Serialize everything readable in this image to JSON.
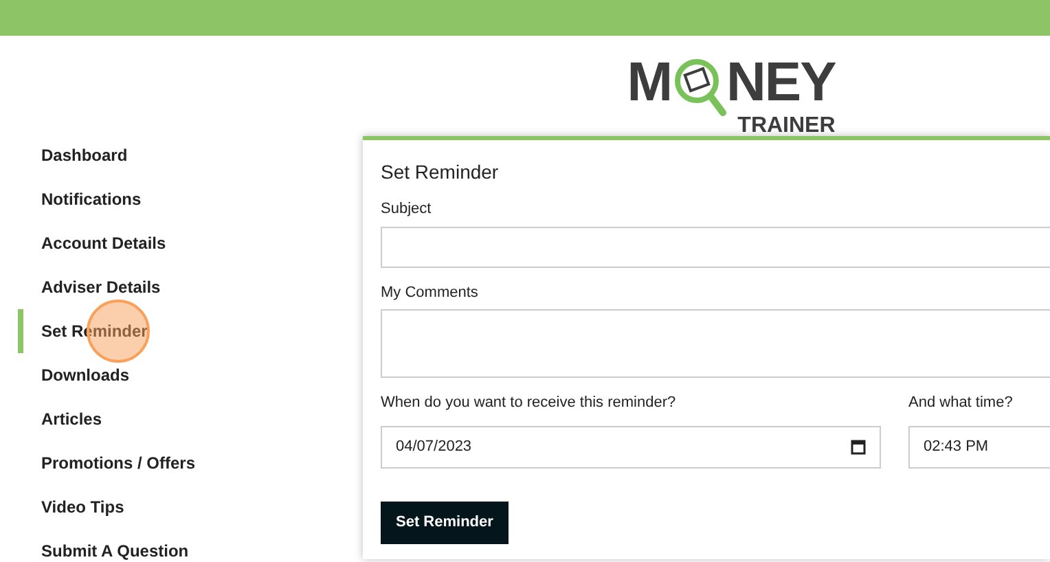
{
  "logo": {
    "before_glass": "M",
    "after_glass": "NEY",
    "subtitle": "TRAINER"
  },
  "sidebar": {
    "items": [
      {
        "label": "Dashboard",
        "selected": false
      },
      {
        "label": "Notifications",
        "selected": false
      },
      {
        "label": "Account Details",
        "selected": false
      },
      {
        "label": "Adviser Details",
        "selected": false
      },
      {
        "label": "Set Reminder",
        "selected": true
      },
      {
        "label": "Downloads",
        "selected": false
      },
      {
        "label": "Articles",
        "selected": false
      },
      {
        "label": "Promotions / Offers",
        "selected": false
      },
      {
        "label": "Video Tips",
        "selected": false
      },
      {
        "label": "Submit A Question",
        "selected": false
      }
    ]
  },
  "form": {
    "title": "Set Reminder",
    "subject_label": "Subject",
    "comments_label": "My Comments",
    "date_label": "When do you want to receive this reminder?",
    "date_value": "04/07/2023",
    "time_label": "And what time?",
    "time_value": "02:43 PM",
    "submit": "Set Reminder"
  }
}
